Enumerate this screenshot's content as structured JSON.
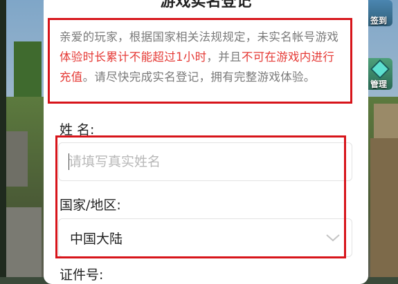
{
  "dialog": {
    "title": "游戏实名登记",
    "notice": {
      "part1": "亲爱的玩家，根据国家相关法规规定，未实名帐号游戏",
      "highlight1": "体验时长累计不能超过1小时",
      "part2": "，并且",
      "highlight2": "不可在游戏内进行充值",
      "part3": "。请尽快完成实名登记，拥有完整游戏体验。"
    },
    "name_field": {
      "label": "姓 名:",
      "placeholder": "请填写真实姓名",
      "value": ""
    },
    "region_field": {
      "label": "国家/地区:",
      "value": "中国大陆"
    },
    "id_field": {
      "label": "证件号:"
    }
  },
  "side_buttons": {
    "checkin": "签到",
    "manage": "管理"
  },
  "colors": {
    "highlight_red": "#e53935",
    "annotation_box": "#d7141a",
    "notice_text": "#7a7a7a"
  }
}
